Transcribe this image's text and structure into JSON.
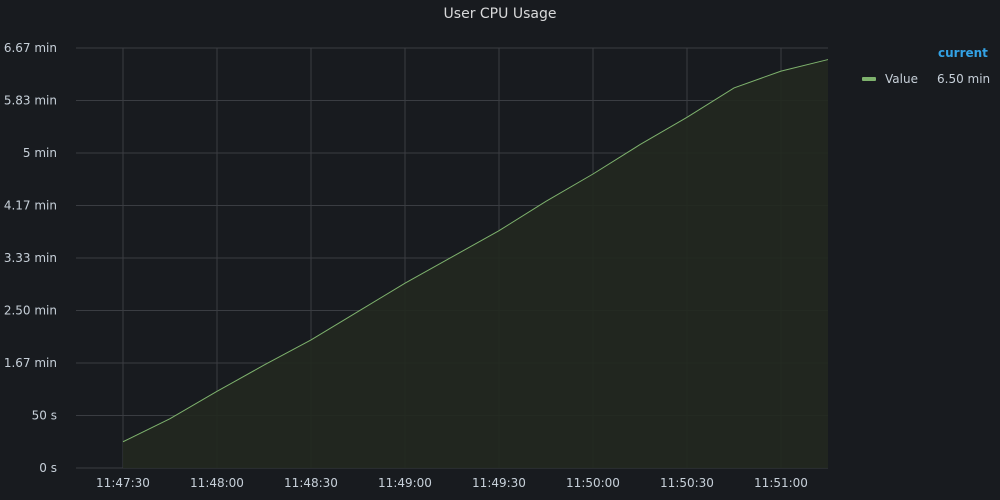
{
  "panel": {
    "title": "User CPU Usage"
  },
  "legend": {
    "header": "current",
    "items": [
      {
        "name": "Value",
        "current": "6.50 min",
        "color": "#7eb26d"
      }
    ]
  },
  "colors": {
    "background": "#181b1f",
    "grid": "#3a3d42",
    "series": "#7eb26d",
    "fill": "#22281f",
    "legend_header": "#33a2e5"
  },
  "chart_data": {
    "type": "area",
    "title": "User CPU Usage",
    "xlabel": "",
    "ylabel": "",
    "grid": true,
    "legend_placement": "right",
    "x_ticks": [
      "11:47:30",
      "11:48:00",
      "11:48:30",
      "11:49:00",
      "11:49:30",
      "11:50:00",
      "11:50:30",
      "11:51:00"
    ],
    "y_ticks": [
      {
        "value": 0,
        "label": "0 s"
      },
      {
        "value": 50,
        "label": "50 s"
      },
      {
        "value": 100,
        "label": "1.67 min"
      },
      {
        "value": 150,
        "label": "2.50 min"
      },
      {
        "value": 200,
        "label": "3.33 min"
      },
      {
        "value": 250,
        "label": "4.17 min"
      },
      {
        "value": 300,
        "label": "5 min"
      },
      {
        "value": 350,
        "label": "5.83 min"
      },
      {
        "value": 400,
        "label": "6.67 min"
      }
    ],
    "xlim": [
      "11:47:15",
      "11:51:15"
    ],
    "ylim": [
      0,
      400
    ],
    "series": [
      {
        "name": "Value",
        "x": [
          "11:47:30",
          "11:47:45",
          "11:48:00",
          "11:48:15",
          "11:48:30",
          "11:48:45",
          "11:49:00",
          "11:49:15",
          "11:49:30",
          "11:49:45",
          "11:50:00",
          "11:50:15",
          "11:50:30",
          "11:50:45",
          "11:51:00",
          "11:51:15"
        ],
        "y": [
          25,
          47,
          73,
          98,
          122,
          149,
          176,
          201,
          226,
          254,
          280,
          308,
          334,
          362,
          378,
          389
        ]
      }
    ]
  }
}
